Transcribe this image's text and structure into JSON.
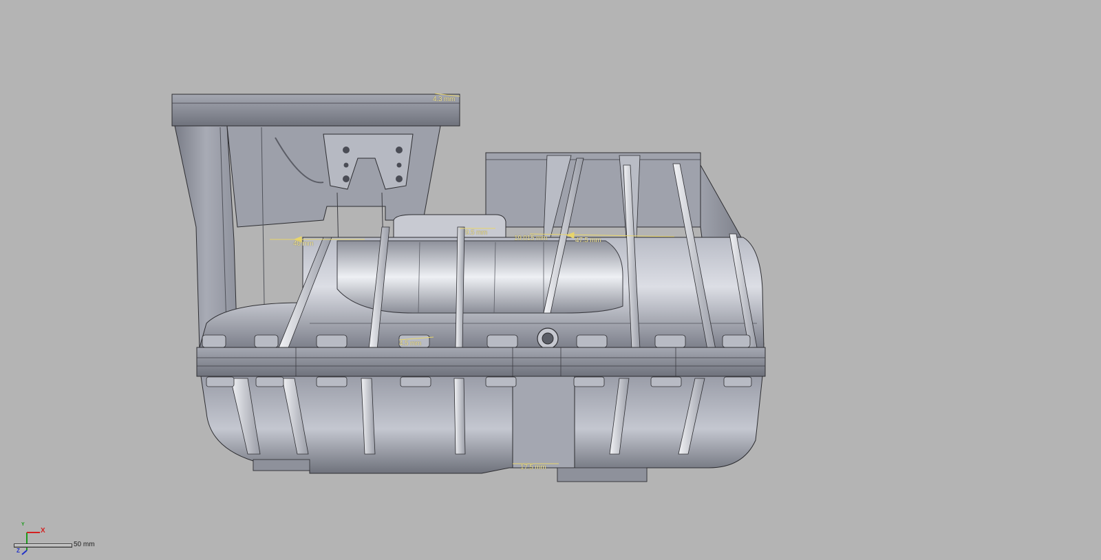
{
  "colors": {
    "background": "#b4b4b4",
    "part_body": "#8c8f9a",
    "dimension_text": "#f3e59a",
    "axis_x": "#d42020",
    "axis_y": "#1a9a1a",
    "axis_z": "#2030c8"
  },
  "dimensions": [
    {
      "label": "4.3 mm"
    },
    {
      "label": "9.5 mm"
    },
    {
      "label": "19.015 mm"
    },
    {
      "label": "47.5 mm"
    },
    {
      "label": "40 mm"
    },
    {
      "label": "4.5 mm"
    },
    {
      "label": "17.5 mm"
    }
  ],
  "triad": {
    "x_label": "X",
    "y_label": "Y",
    "z_label": "Z",
    "icon": "coordinate-triad-icon"
  },
  "scale": {
    "label": "50 mm"
  }
}
